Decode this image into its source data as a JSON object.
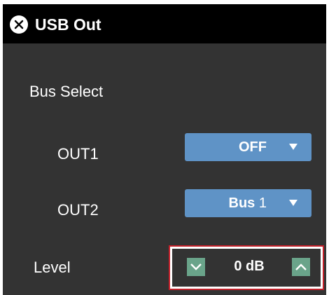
{
  "window": {
    "title": "USB Out",
    "close_icon": "close-circle-icon"
  },
  "bus_select": {
    "heading": "Bus Select",
    "outputs": [
      {
        "label": "OUT1",
        "value_bold": "OFF",
        "value_number": ""
      },
      {
        "label": "OUT2",
        "value_bold": "Bus",
        "value_number": "1"
      }
    ],
    "caret_icon": "triangle-down-icon"
  },
  "level": {
    "label": "Level",
    "value": "0 dB",
    "decrement_icon": "chevron-down-icon",
    "increment_icon": "chevron-up-icon"
  },
  "colors": {
    "background": "#333333",
    "titlebar": "#000000",
    "dropdown": "#5f93c6",
    "stepper": "#6aa48a",
    "highlight_border": "#c4202a"
  }
}
